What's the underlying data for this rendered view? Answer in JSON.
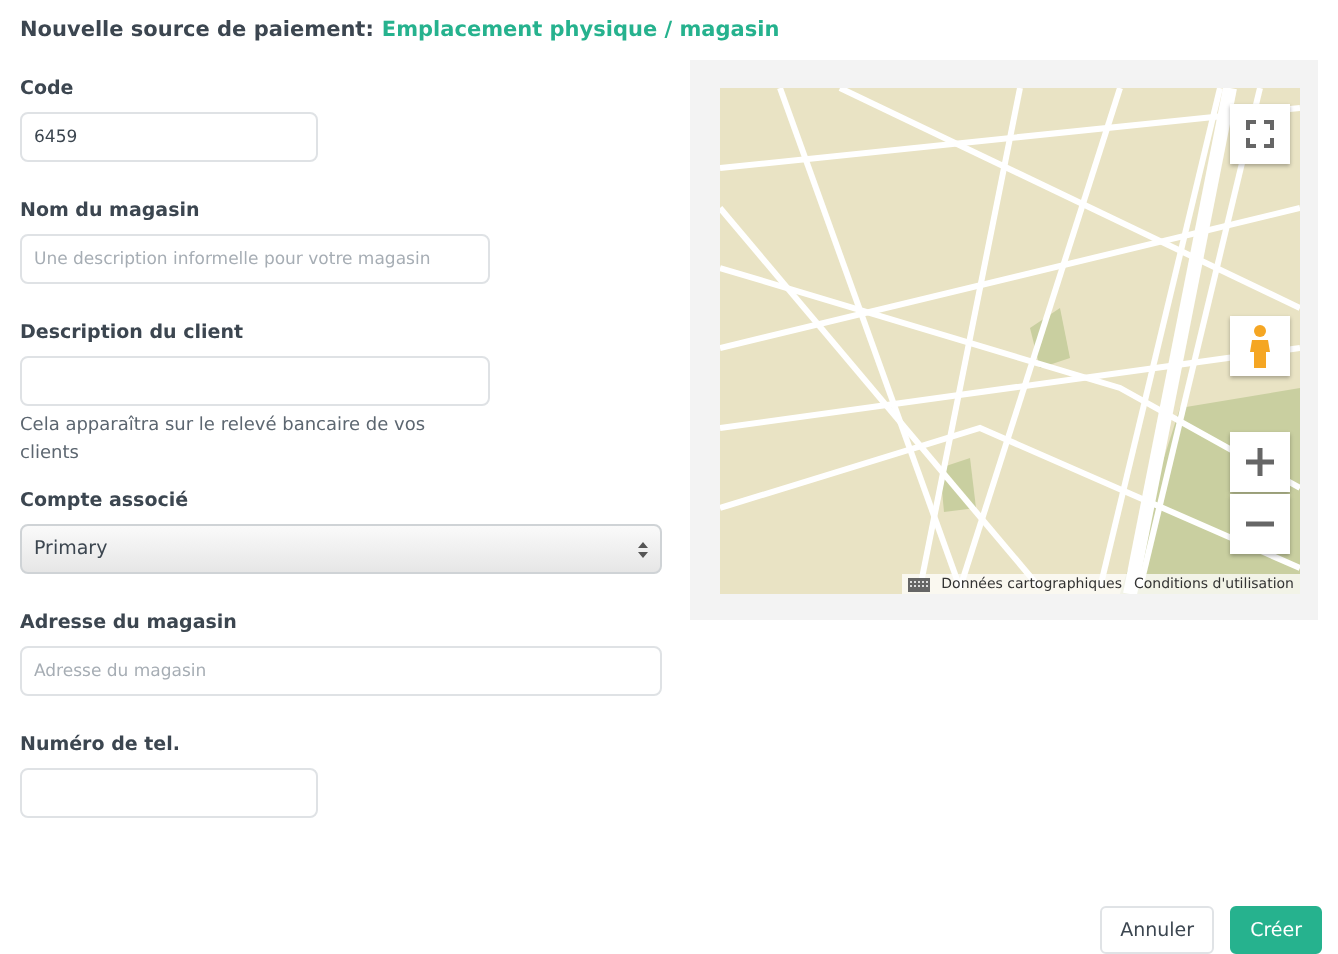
{
  "header": {
    "title": "Nouvelle source de paiement:",
    "subtitle": "Emplacement physique / magasin"
  },
  "fields": [
    {
      "kind": "input",
      "label": "Code",
      "value": "6459"
    },
    {
      "kind": "input",
      "label": "Nom du magasin",
      "placeholder": "Une description informelle pour votre magasin"
    },
    {
      "kind": "input",
      "label": "Description du client",
      "help": "Cela apparaîtra sur le relevé bancaire de vos clients"
    },
    {
      "kind": "select",
      "label": "Compte associé",
      "value": "Primary"
    },
    {
      "kind": "input",
      "label": "Adresse du magasin",
      "placeholder": "Adresse du magasin"
    },
    {
      "kind": "input",
      "label": "Numéro de tel."
    }
  ],
  "map": {
    "attribution": "Données cartographiques",
    "terms": "Conditions d'utilisation"
  },
  "buttons": [
    {
      "label": "Annuler",
      "kind": "secondary"
    },
    {
      "label": "Créer",
      "kind": "primary"
    }
  ]
}
